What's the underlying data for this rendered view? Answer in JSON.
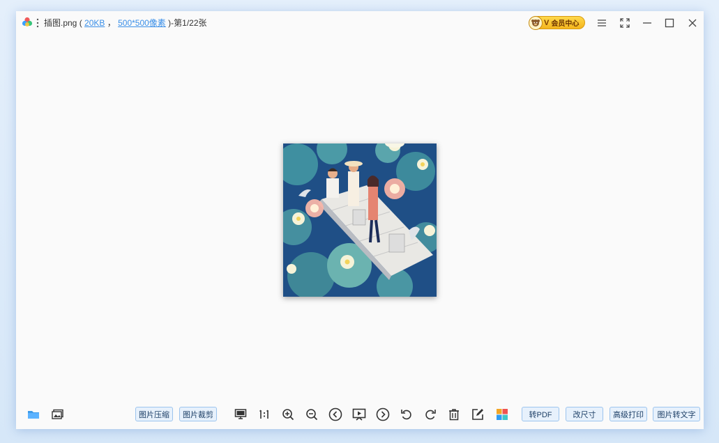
{
  "title": {
    "filename": "插图.png (",
    "size": "20KB",
    "sep": "，",
    "dims": "500*500像素",
    "page": ")-第1/22张"
  },
  "vip": {
    "v": "V",
    "label": "会员中心"
  },
  "toolbar_left": {
    "compress": "图片压缩",
    "crop": "图片裁剪"
  },
  "toolbar_right": {
    "to_pdf": "转PDF",
    "resize": "改尺寸",
    "print": "高级打印",
    "ocr": "图片转文字"
  },
  "colors": {
    "accent": "#3a8fe8",
    "vip": "#f4b51d",
    "button_bg": "#e7f1fc",
    "button_border": "#9cc4ee"
  }
}
